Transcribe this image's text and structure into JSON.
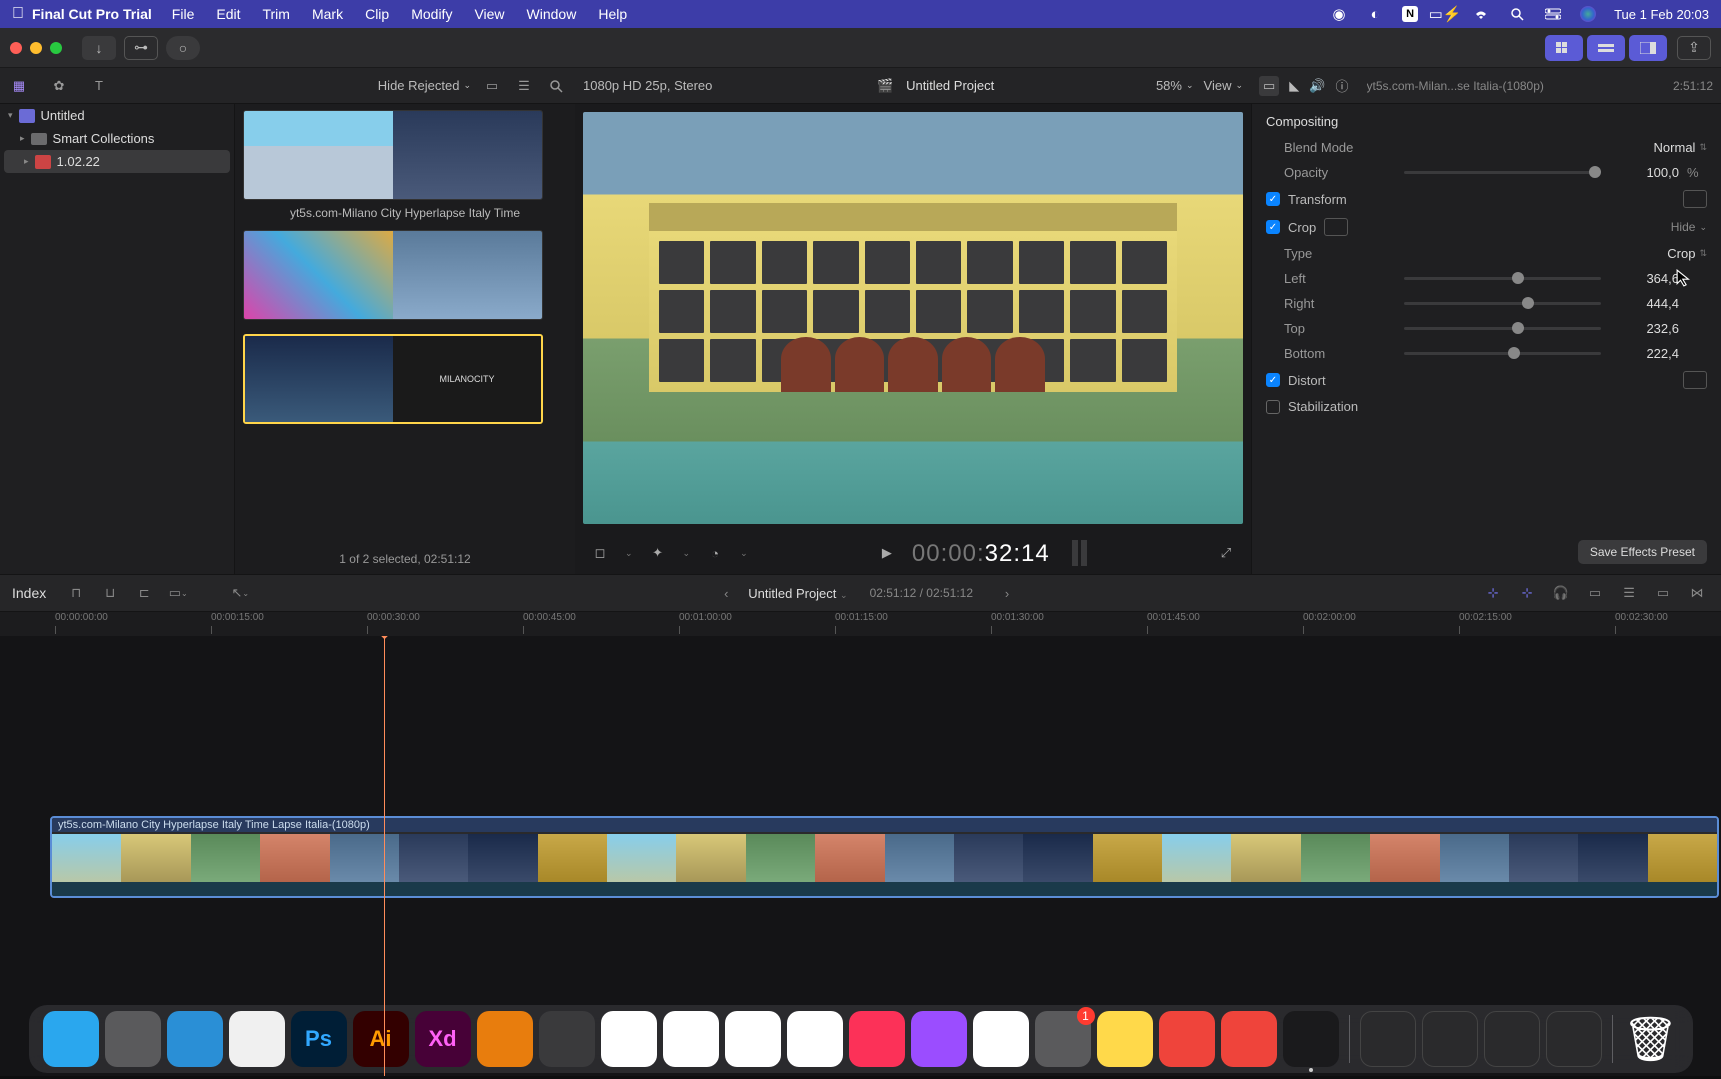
{
  "menubar": {
    "app": "Final Cut Pro Trial",
    "items": [
      "File",
      "Edit",
      "Trim",
      "Mark",
      "Clip",
      "Modify",
      "View",
      "Window",
      "Help"
    ],
    "clock": "Tue 1 Feb  20:03"
  },
  "sidebar": {
    "library": "Untitled",
    "smart": "Smart Collections",
    "event": "1.02.22"
  },
  "browser": {
    "filter": "Hide Rejected",
    "clip_caption": "yt5s.com-Milano City Hyperlapse Italy Time",
    "status": "1 of 2 selected, 02:51:12"
  },
  "viewer": {
    "format": "1080p HD 25p, Stereo",
    "project": "Untitled Project",
    "zoom": "58%",
    "view_label": "View",
    "timecode_gray": "00:00:",
    "timecode_white": "32:14"
  },
  "inspector": {
    "clip_title": "yt5s.com-Milan...se Italia-(1080p)",
    "duration": "2:51:12",
    "compositing": "Compositing",
    "blend_mode_label": "Blend Mode",
    "blend_mode_value": "Normal",
    "opacity_label": "Opacity",
    "opacity_value": "100,0",
    "opacity_unit": "%",
    "transform": "Transform",
    "crop": "Crop",
    "hide": "Hide",
    "type_label": "Type",
    "type_value": "Crop",
    "left_label": "Left",
    "left_value": "364,6",
    "right_label": "Right",
    "right_value": "444,4",
    "top_label": "Top",
    "top_value": "232,6",
    "bottom_label": "Bottom",
    "bottom_value": "222,4",
    "distort": "Distort",
    "stabilization": "Stabilization",
    "save_preset": "Save Effects Preset"
  },
  "timeline": {
    "index": "Index",
    "project": "Untitled Project",
    "position": "02:51:12 / 02:51:12",
    "clip_name": "yt5s.com-Milano City Hyperlapse Italy Time Lapse Italia-(1080p)",
    "ticks": [
      "00:00:00:00",
      "00:00:15:00",
      "00:00:30:00",
      "00:00:45:00",
      "00:01:00:00",
      "00:01:15:00",
      "00:01:30:00",
      "00:01:45:00",
      "00:02:00:00",
      "00:02:15:00",
      "00:02:30:00"
    ]
  },
  "dock": {
    "apps": [
      {
        "name": "finder",
        "bg": "#2aa7ee"
      },
      {
        "name": "launchpad",
        "bg": "#5a5a5c"
      },
      {
        "name": "safari",
        "bg": "#2a8fd6"
      },
      {
        "name": "chrome",
        "bg": "#f0f0f0"
      },
      {
        "name": "photoshop",
        "bg": "#001e36",
        "txt": "Ps",
        "fg": "#31a8ff"
      },
      {
        "name": "illustrator",
        "bg": "#330000",
        "txt": "Ai",
        "fg": "#ff9a00"
      },
      {
        "name": "xd",
        "bg": "#470137",
        "txt": "Xd",
        "fg": "#ff61f6"
      },
      {
        "name": "blender",
        "bg": "#e87d0d"
      },
      {
        "name": "krita",
        "bg": "#3a3a3c"
      },
      {
        "name": "messenger",
        "bg": "#fff"
      },
      {
        "name": "mail",
        "bg": "#fff"
      },
      {
        "name": "maps",
        "bg": "#fff"
      },
      {
        "name": "photos",
        "bg": "#fff"
      },
      {
        "name": "music",
        "bg": "#fc3158"
      },
      {
        "name": "podcasts",
        "bg": "#9b4dff"
      },
      {
        "name": "numbers",
        "bg": "#fff"
      },
      {
        "name": "settings",
        "bg": "#5a5a5c",
        "badge": "1"
      },
      {
        "name": "notes",
        "bg": "#ffd94a"
      },
      {
        "name": "anydesk1",
        "bg": "#ef443b"
      },
      {
        "name": "anydesk2",
        "bg": "#ef443b"
      },
      {
        "name": "finalcut",
        "bg": "#1a1a1c",
        "running": true
      }
    ],
    "minis": 4,
    "trash": true
  }
}
